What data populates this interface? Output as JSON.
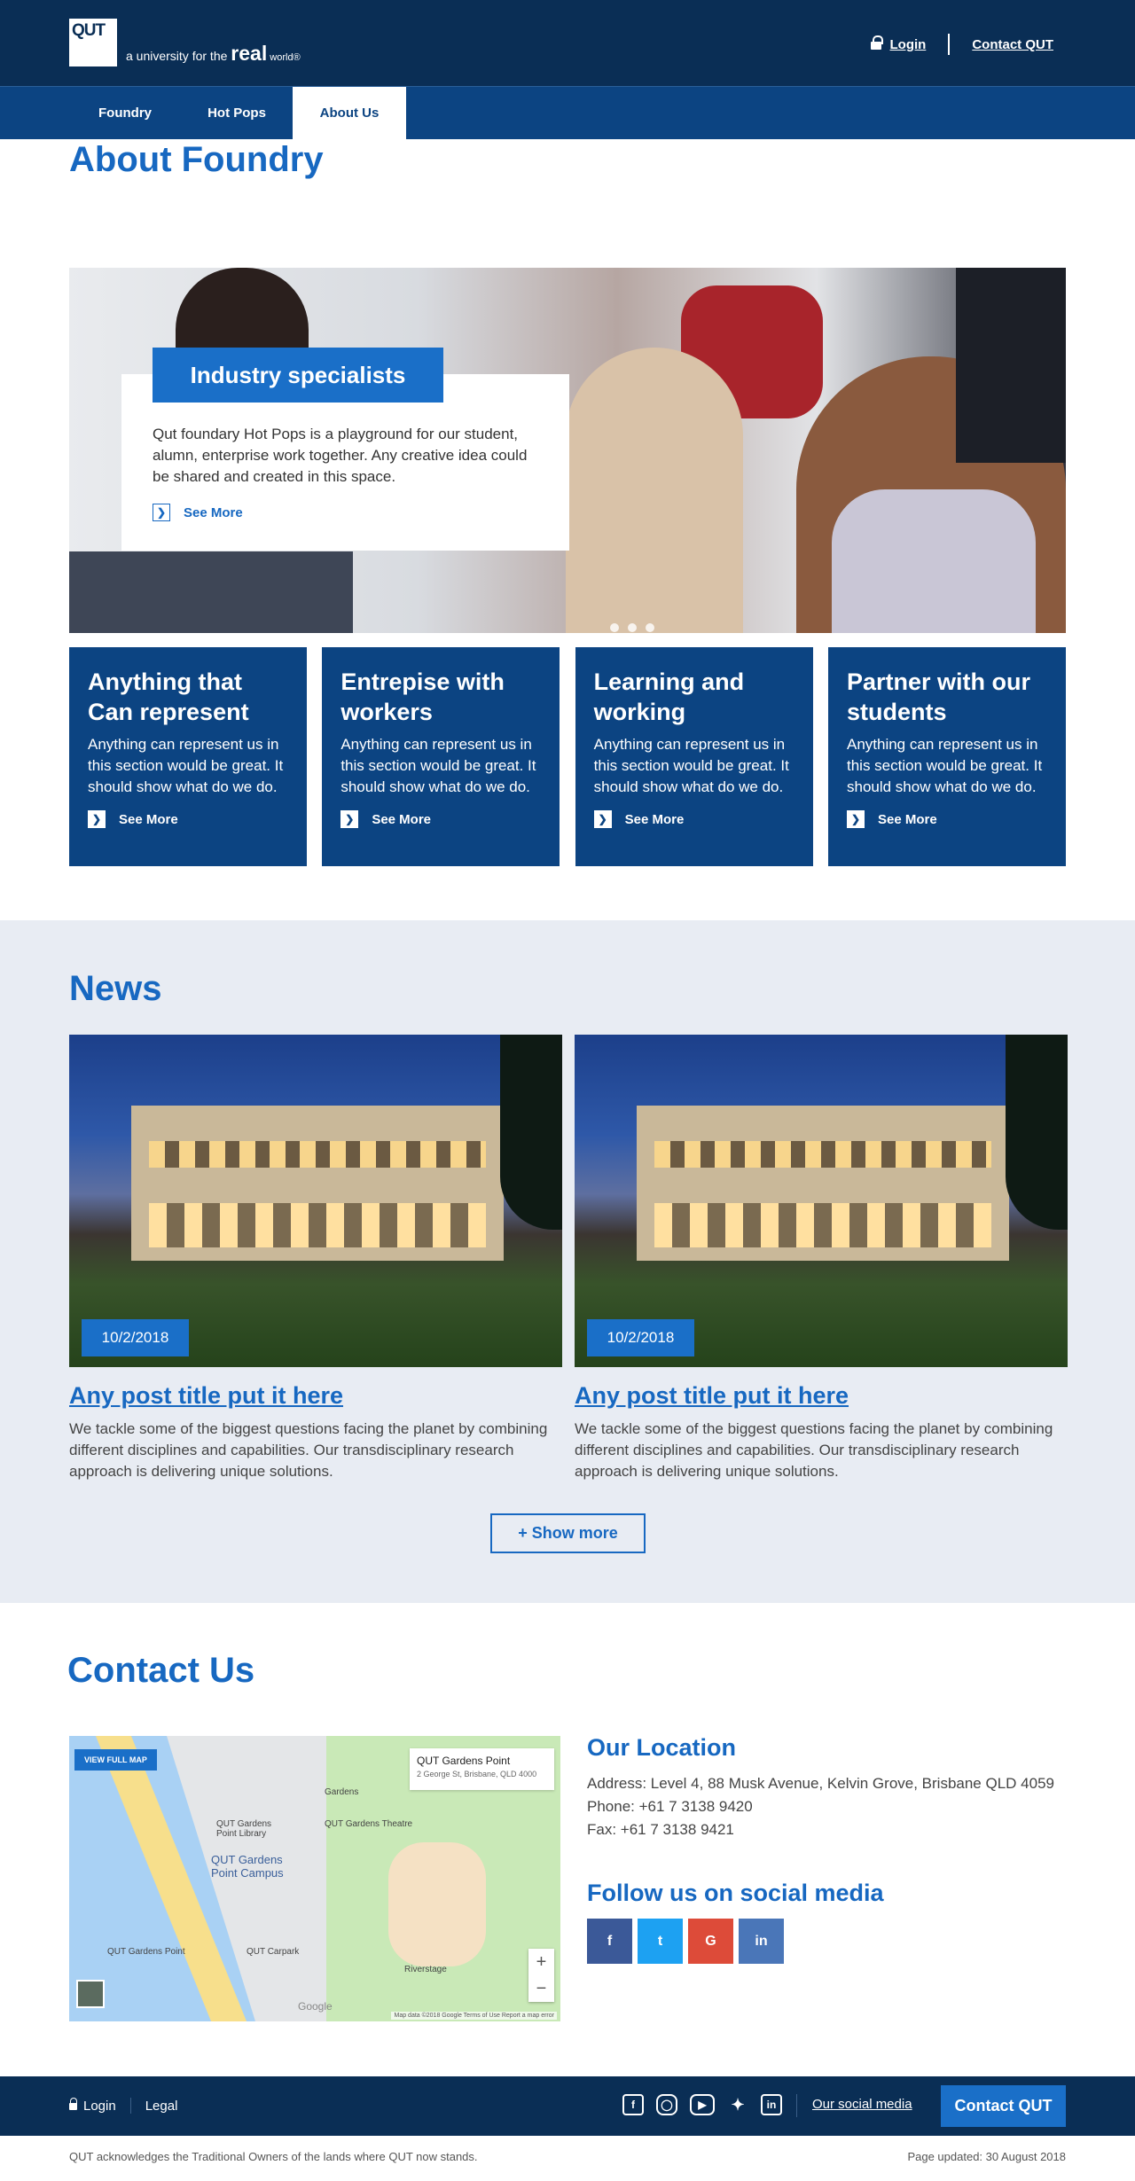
{
  "header": {
    "logo_text": "QUT",
    "tagline_pre": "a university for the ",
    "tagline_bold": "real",
    "tagline_post": " world",
    "tagline_mark": "®",
    "login": "Login",
    "contact": "Contact QUT"
  },
  "nav": {
    "items": [
      "Foundry",
      "Hot Pops",
      "About Us"
    ],
    "active": "About Us"
  },
  "about": {
    "title": "About Foundry",
    "hero_label": "Industry specialists",
    "hero_text": "Qut foundary Hot Pops is a playground for our student, alumn, enterprise work together. Any creative idea could be shared and created in this space.",
    "hero_more": "See More"
  },
  "cards": [
    {
      "title": "Anything that Can represent",
      "text": "Anything can represent us in this section would be great. It should show what do we do.",
      "more": "See More"
    },
    {
      "title": "Entrepise with workers",
      "text": "Anything can represent us in this section would be great. It should show what do we do.",
      "more": "See More"
    },
    {
      "title": "Learning and working",
      "text": "Anything can represent us in this section would be great. It should show what do we do.",
      "more": "See More"
    },
    {
      "title": "Partner with our students",
      "text": "Anything can represent us in this section would be great. It should show what do we do.",
      "more": "See More"
    }
  ],
  "news": {
    "title": "News",
    "posts": [
      {
        "date": "10/2/2018",
        "title": "Any post title put it here",
        "body": "We tackle some of the biggest questions facing the planet by combining different disciplines and capabilities. Our transdisciplinary research approach is delivering unique solutions."
      },
      {
        "date": "10/2/2018",
        "title": "Any post title put it here",
        "body": "We tackle some of the biggest questions facing the planet by combining different disciplines and capabilities. Our transdisciplinary research approach is delivering unique solutions."
      }
    ],
    "show_more": "+ Show more"
  },
  "contact": {
    "title": "Contact Us",
    "map": {
      "view_full": "VIEW FULL MAP",
      "place": "QUT Gardens Point",
      "address": "2 George St, Brisbane, QLD 4000",
      "labels": {
        "campus": "QUT Gardens Point Campus",
        "library": "QUT Gardens Point Library",
        "theatre": "QUT Gardens Theatre",
        "carpark": "QUT Carpark",
        "riverstage": "Riverstage",
        "gardens": "Gardens",
        "ferry": "QUT Gardens Point"
      },
      "attribution": "Map data ©2018 Google   Terms of Use   Report a map error",
      "google": "Google"
    },
    "location_title": "Our Location",
    "address": "Address: Level 4, 88 Musk Avenue, Kelvin Grove, Brisbane QLD 4059",
    "phone": "Phone: +61 7 3138 9420",
    "fax": "Fax: +61 7 3138 9421",
    "social_title": "Follow us on social media",
    "social": [
      {
        "icon": "facebook-icon",
        "glyph": "f",
        "color": "#3b5998"
      },
      {
        "icon": "twitter-icon",
        "glyph": "t",
        "color": "#1da1f2"
      },
      {
        "icon": "google-plus-icon",
        "glyph": "G",
        "color": "#dd4b39"
      },
      {
        "icon": "linkedin-icon",
        "glyph": "in",
        "color": "#4a76b8"
      }
    ]
  },
  "footer": {
    "login": "Login",
    "legal": "Legal",
    "social_link": "Our social media",
    "contact": "Contact QUT",
    "ack": "QUT acknowledges the Traditional Owners of the lands where QUT now stands.",
    "updated": "Page updated: 30 August 2018"
  },
  "colors": {
    "navy": "#0a2e55",
    "nav_blue": "#0c4482",
    "accent": "#1768c1"
  }
}
